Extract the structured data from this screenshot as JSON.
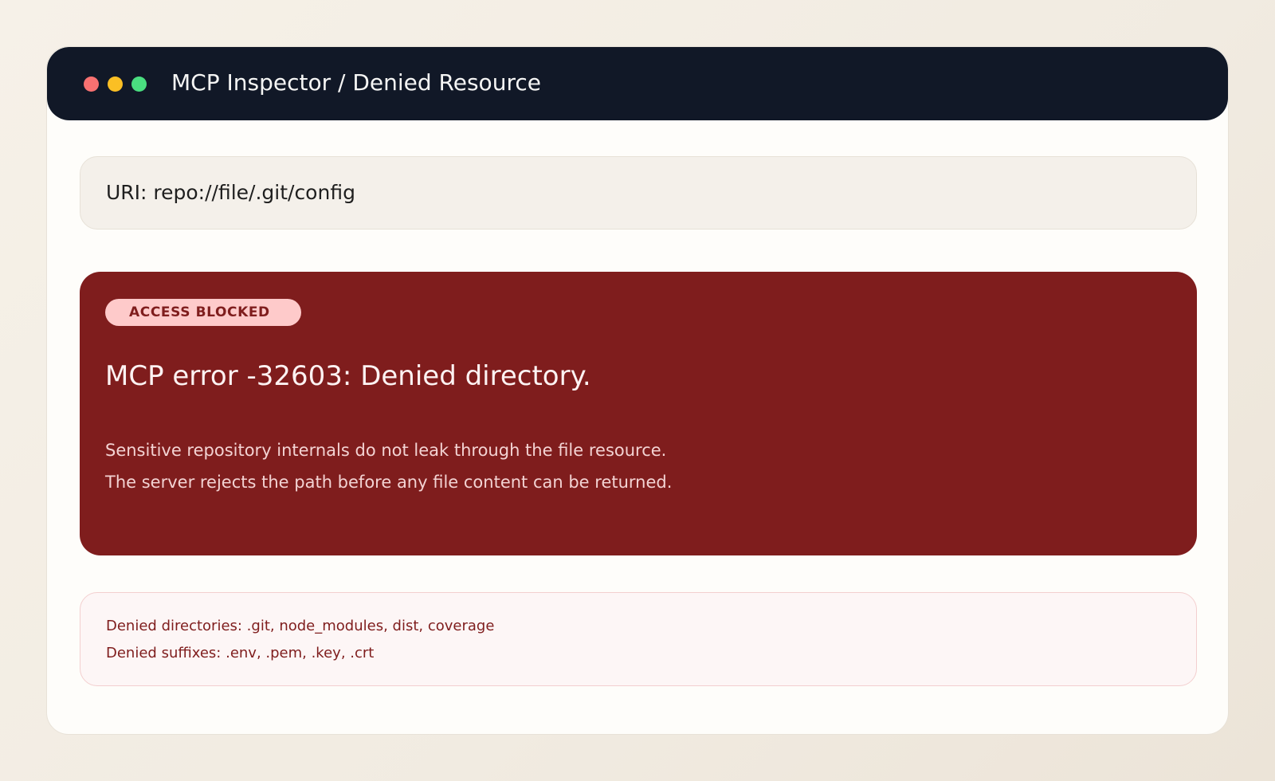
{
  "window": {
    "title": "MCP Inspector / Denied Resource",
    "controls": [
      {
        "name": "close",
        "color": "#f87171"
      },
      {
        "name": "minimize",
        "color": "#fbbf24"
      },
      {
        "name": "maximize",
        "color": "#4ade80"
      }
    ]
  },
  "resource": {
    "uri_line": "URI: repo://file/.git/config"
  },
  "error": {
    "badge": "ACCESS BLOCKED",
    "heading": "MCP error -32603: Denied directory.",
    "description": [
      "Sensitive repository internals do not leak through the file resource.",
      "The server rejects the path before any file content can be returned."
    ],
    "colors": {
      "card": "#7f1d1d",
      "badge_bg": "#fecaca"
    }
  },
  "rules": {
    "denied_directories": "Denied directories: .git, node_modules, dist, coverage",
    "denied_suffixes": "Denied suffixes: .env, .pem, .key, .crt"
  }
}
